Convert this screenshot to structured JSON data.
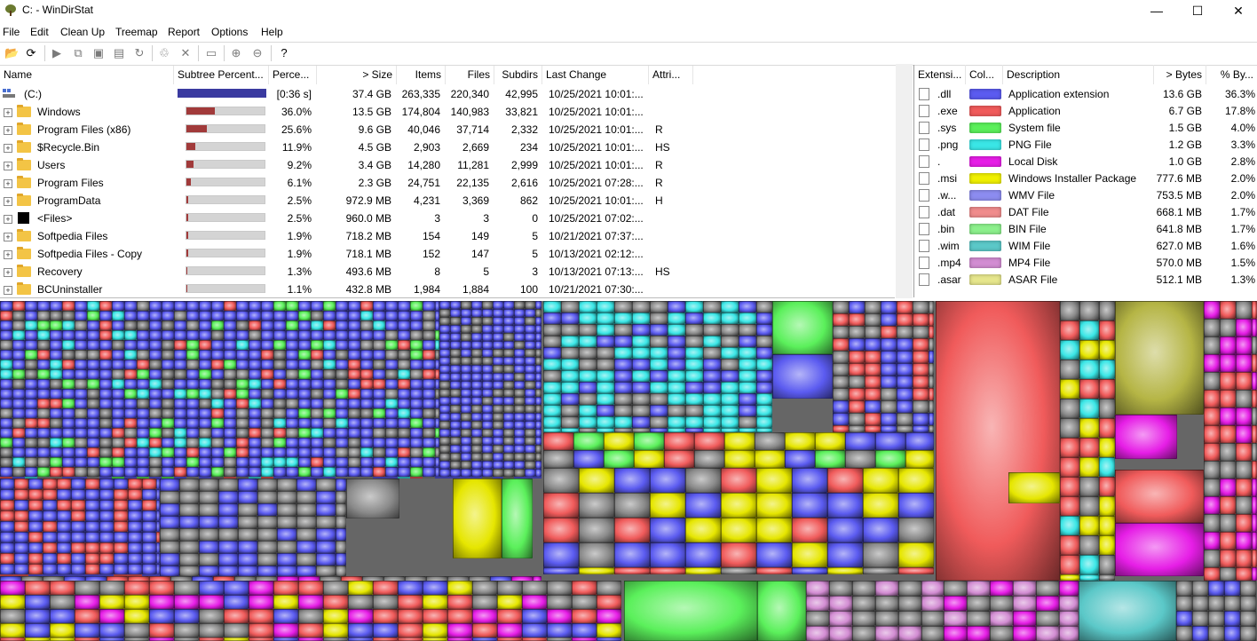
{
  "window": {
    "title": "C: - WinDirStat",
    "minimize": "—",
    "maximize": "☐",
    "close": "✕"
  },
  "menu": [
    "File",
    "Edit",
    "Clean Up",
    "Treemap",
    "Report",
    "Options",
    "Help"
  ],
  "toolbar": {
    "icons": [
      "open-icon",
      "refresh-icon",
      "play-icon",
      "copy-path-icon",
      "explorer-icon",
      "command-prompt-icon",
      "refresh-selected-icon",
      "recycle-icon",
      "delete-icon",
      "new-folder-icon",
      "zoom-in-icon",
      "zoom-out-icon",
      "help-icon"
    ]
  },
  "tree": {
    "headers": [
      "Name",
      "Subtree Percent...",
      "Perce...",
      "> Size",
      "Items",
      "Files",
      "Subdirs",
      "Last Change",
      "Attri..."
    ],
    "rows": [
      {
        "name": "(C:)",
        "percent": "[0:36 s]",
        "size": "37.4 GB",
        "items": "263,335",
        "files": "220,340",
        "subdirs": "42,995",
        "last_change": "10/25/2021  10:01:...",
        "attr": "",
        "fill": 1.0
      },
      {
        "name": "Windows",
        "percent": "36.0%",
        "size": "13.5 GB",
        "items": "174,804",
        "files": "140,983",
        "subdirs": "33,821",
        "last_change": "10/25/2021  10:01:...",
        "attr": "",
        "fill": 0.36
      },
      {
        "name": "Program Files (x86)",
        "percent": "25.6%",
        "size": "9.6 GB",
        "items": "40,046",
        "files": "37,714",
        "subdirs": "2,332",
        "last_change": "10/25/2021  10:01:...",
        "attr": "R",
        "fill": 0.256
      },
      {
        "name": "$Recycle.Bin",
        "percent": "11.9%",
        "size": "4.5 GB",
        "items": "2,903",
        "files": "2,669",
        "subdirs": "234",
        "last_change": "10/25/2021  10:01:...",
        "attr": "HS",
        "fill": 0.119
      },
      {
        "name": "Users",
        "percent": "9.2%",
        "size": "3.4 GB",
        "items": "14,280",
        "files": "11,281",
        "subdirs": "2,999",
        "last_change": "10/25/2021  10:01:...",
        "attr": "R",
        "fill": 0.092
      },
      {
        "name": "Program Files",
        "percent": "6.1%",
        "size": "2.3 GB",
        "items": "24,751",
        "files": "22,135",
        "subdirs": "2,616",
        "last_change": "10/25/2021  07:28:...",
        "attr": "R",
        "fill": 0.061
      },
      {
        "name": "ProgramData",
        "percent": "2.5%",
        "size": "972.9 MB",
        "items": "4,231",
        "files": "3,369",
        "subdirs": "862",
        "last_change": "10/25/2021  10:01:...",
        "attr": "H",
        "fill": 0.025
      },
      {
        "name": "<Files>",
        "percent": "2.5%",
        "size": "960.0 MB",
        "items": "3",
        "files": "3",
        "subdirs": "0",
        "last_change": "10/25/2021  07:02:...",
        "attr": "",
        "fill": 0.025
      },
      {
        "name": "Softpedia Files",
        "percent": "1.9%",
        "size": "718.2 MB",
        "items": "154",
        "files": "149",
        "subdirs": "5",
        "last_change": "10/21/2021  07:37:...",
        "attr": "",
        "fill": 0.019
      },
      {
        "name": "Softpedia Files - Copy",
        "percent": "1.9%",
        "size": "718.1 MB",
        "items": "152",
        "files": "147",
        "subdirs": "5",
        "last_change": "10/13/2021  02:12:...",
        "attr": "",
        "fill": 0.019
      },
      {
        "name": "Recovery",
        "percent": "1.3%",
        "size": "493.6 MB",
        "items": "8",
        "files": "5",
        "subdirs": "3",
        "last_change": "10/13/2021  07:13:...",
        "attr": "HS",
        "fill": 0.013
      },
      {
        "name": "BCUninstaller",
        "percent": "1.1%",
        "size": "432.8 MB",
        "items": "1,984",
        "files": "1,884",
        "subdirs": "100",
        "last_change": "10/21/2021  07:30:...",
        "attr": "",
        "fill": 0.011
      }
    ]
  },
  "extensions": {
    "headers": [
      "Extensi...",
      "Col...",
      "Description",
      "> Bytes",
      "% By..."
    ],
    "rows": [
      {
        "ext": ".dll",
        "color": "#5b5bf0",
        "description": "Application extension",
        "bytes": "13.6 GB",
        "percent": "36.3%"
      },
      {
        "ext": ".exe",
        "color": "#f05b5b",
        "description": "Application",
        "bytes": "6.7 GB",
        "percent": "17.8%"
      },
      {
        "ext": ".sys",
        "color": "#5bf05b",
        "description": "System file",
        "bytes": "1.5 GB",
        "percent": "4.0%"
      },
      {
        "ext": ".png",
        "color": "#3ae6e6",
        "description": "PNG File",
        "bytes": "1.2 GB",
        "percent": "3.3%"
      },
      {
        "ext": ".",
        "color": "#e61ee6",
        "description": "Local Disk",
        "bytes": "1.0 GB",
        "percent": "2.8%"
      },
      {
        "ext": ".msi",
        "color": "#f0f000",
        "description": "Windows Installer Package",
        "bytes": "777.6 MB",
        "percent": "2.0%"
      },
      {
        "ext": ".w...",
        "color": "#8c8cf0",
        "description": "WMV File",
        "bytes": "753.5 MB",
        "percent": "2.0%"
      },
      {
        "ext": ".dat",
        "color": "#f08c8c",
        "description": "DAT File",
        "bytes": "668.1 MB",
        "percent": "1.7%"
      },
      {
        "ext": ".bin",
        "color": "#8cf08c",
        "description": "BIN File",
        "bytes": "641.8 MB",
        "percent": "1.7%"
      },
      {
        "ext": ".wim",
        "color": "#5bc8c8",
        "description": "WIM File",
        "bytes": "627.0 MB",
        "percent": "1.6%"
      },
      {
        "ext": ".mp4",
        "color": "#d28cd2",
        "description": "MP4 File",
        "bytes": "570.0 MB",
        "percent": "1.5%"
      },
      {
        "ext": ".asar",
        "color": "#e6e68c",
        "description": "ASAR File",
        "bytes": "512.1 MB",
        "percent": "1.3%"
      }
    ]
  }
}
